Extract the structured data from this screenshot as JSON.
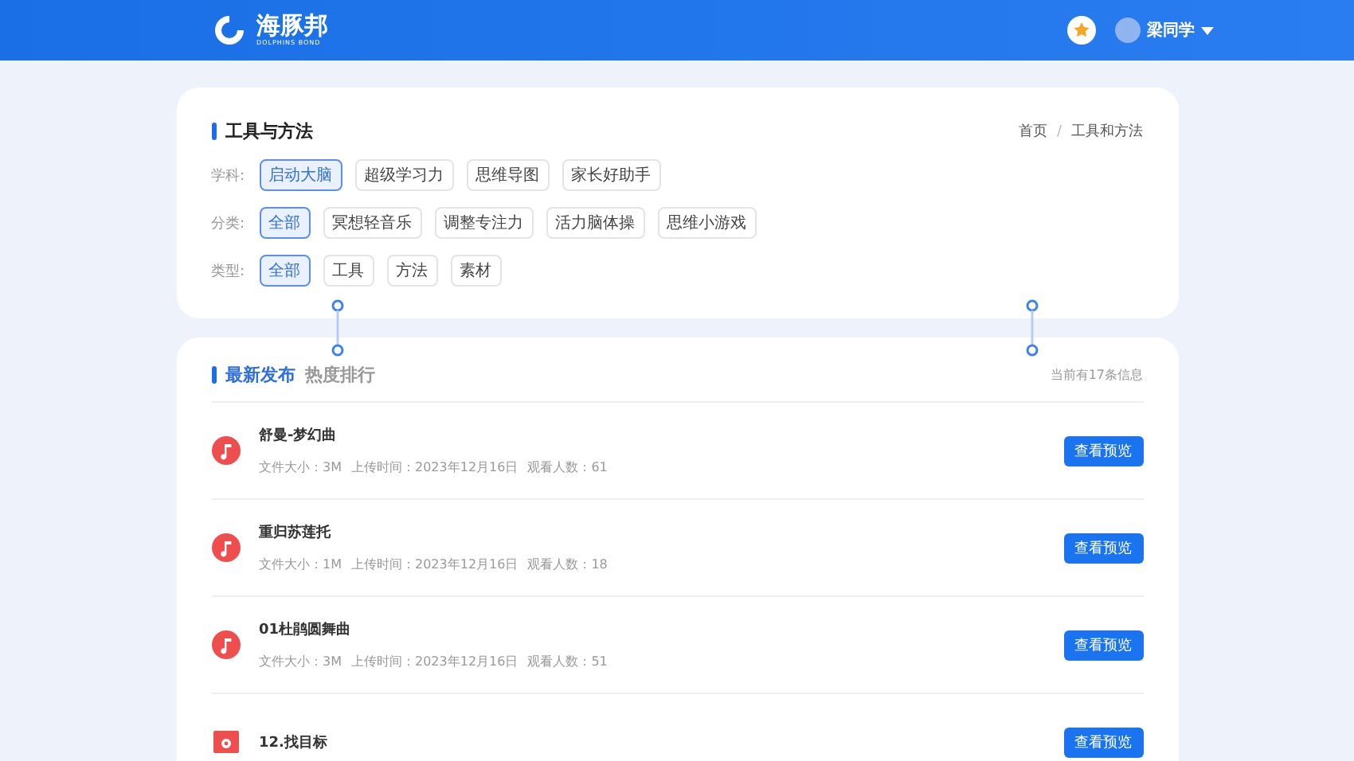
{
  "header": {
    "logo_text": "海豚邦",
    "logo_subtext": "DOLPHINS BOND",
    "username": "梁同学"
  },
  "filter_card": {
    "title": "工具与方法",
    "breadcrumb": [
      "首页",
      "工具和方法"
    ],
    "breadcrumb_separator": "/",
    "filters": [
      {
        "label": "学科:",
        "options": [
          {
            "label": "启动大脑",
            "selected": true
          },
          {
            "label": "超级学习力",
            "selected": false
          },
          {
            "label": "思维导图",
            "selected": false
          },
          {
            "label": "家长好助手",
            "selected": false
          }
        ]
      },
      {
        "label": "分类:",
        "options": [
          {
            "label": "全部",
            "selected": true
          },
          {
            "label": "冥想轻音乐",
            "selected": false
          },
          {
            "label": "调整专注力",
            "selected": false
          },
          {
            "label": "活力脑体操",
            "selected": false
          },
          {
            "label": "思维小游戏",
            "selected": false
          }
        ]
      },
      {
        "label": "类型:",
        "options": [
          {
            "label": "全部",
            "selected": true
          },
          {
            "label": "工具",
            "selected": false
          },
          {
            "label": "方法",
            "selected": false
          },
          {
            "label": "素材",
            "selected": false
          }
        ]
      }
    ]
  },
  "list_card": {
    "tabs": [
      {
        "label": "最新发布",
        "selected": true
      },
      {
        "label": "热度排行",
        "selected": false
      }
    ],
    "count": "当前有17条信息",
    "items": [
      {
        "kind": "music",
        "title": "舒曼-梦幻曲",
        "size": "文件大小：3M",
        "time": "上传时间：2023年12月16日",
        "views": "观看人数：61",
        "button": "查看预览"
      },
      {
        "kind": "music",
        "title": "重归苏莲托",
        "size": "文件大小：1M",
        "time": "上传时间：2023年12月16日",
        "views": "观看人数：18",
        "button": "查看预览"
      },
      {
        "kind": "music",
        "title": "01杜鹃圆舞曲",
        "size": "文件大小：3M",
        "time": "上传时间：2023年12月16日",
        "views": "观看人数：51",
        "button": "查看预览"
      },
      {
        "kind": "video",
        "title": "12.找目标",
        "button": "查看预览"
      }
    ]
  }
}
